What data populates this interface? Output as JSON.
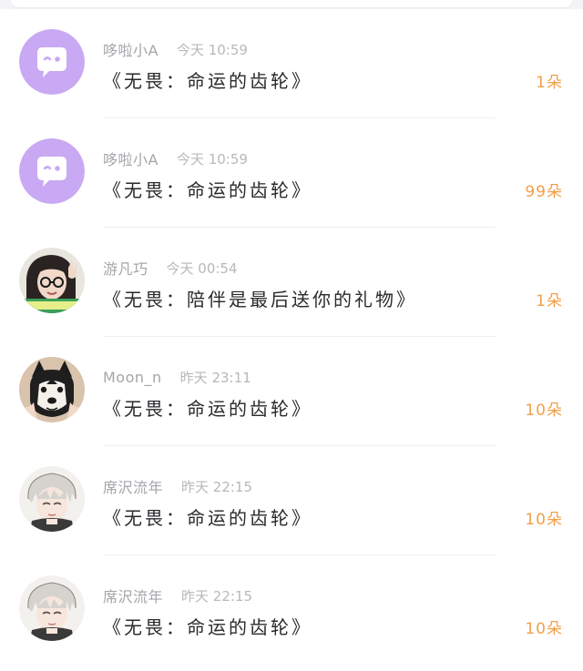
{
  "gifts": [
    {
      "user": "哆啦小A",
      "time": "今天 10:59",
      "title": "《无畏：命运的齿轮》",
      "count": "1朵",
      "avatar_icon": "chat-bubble-avatar"
    },
    {
      "user": "哆啦小A",
      "time": "今天 10:59",
      "title": "《无畏：命运的齿轮》",
      "count": "99朵",
      "avatar_icon": "chat-bubble-avatar"
    },
    {
      "user": "游凡巧",
      "time": "今天 00:54",
      "title": "《无畏：陪伴是最后送你的礼物》",
      "count": "1朵",
      "avatar_icon": "photo-avatar"
    },
    {
      "user": "Moon_n",
      "time": "昨天 23:11",
      "title": "《无畏：命运的齿轮》",
      "count": "10朵",
      "avatar_icon": "husky-avatar"
    },
    {
      "user": "席沢流年",
      "time": "昨天 22:15",
      "title": "《无畏：命运的齿轮》",
      "count": "10朵",
      "avatar_icon": "anime-avatar"
    },
    {
      "user": "席沢流年",
      "time": "昨天 22:15",
      "title": "《无畏：命运的齿轮》",
      "count": "10朵",
      "avatar_icon": "anime-avatar"
    }
  ],
  "colors": {
    "accent_count": "#f0a04a",
    "bubble_avatar_bg": "#c9a9f3",
    "name_gray": "#a5a5ab"
  }
}
